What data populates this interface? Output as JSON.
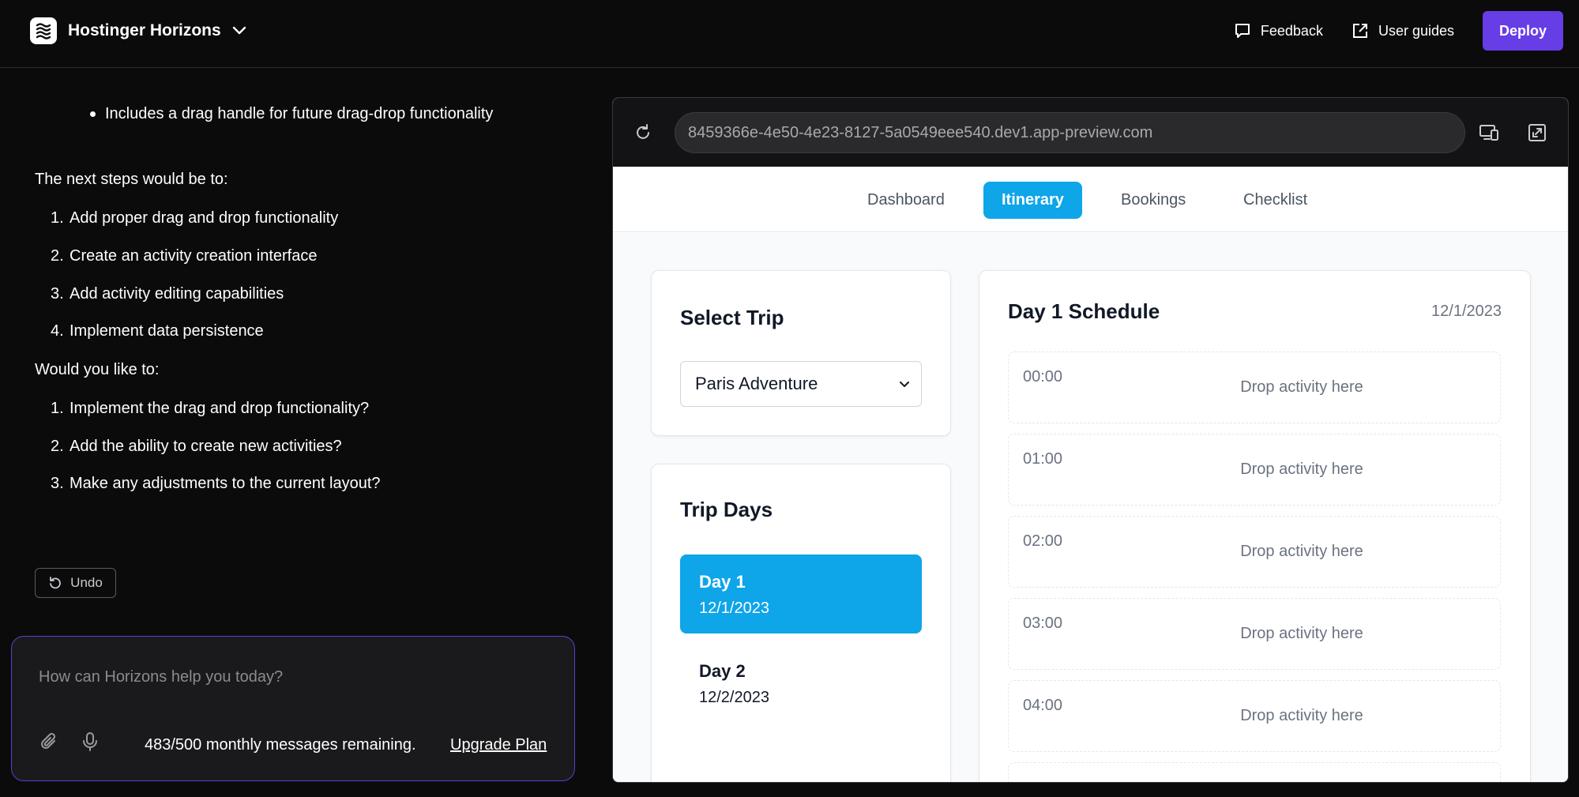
{
  "header": {
    "brand": "Hostinger Horizons",
    "feedback": "Feedback",
    "user_guides": "User guides",
    "deploy": "Deploy"
  },
  "chat": {
    "bullet": "Includes a drag handle for future drag-drop functionality",
    "next_steps_intro": "The next steps would be to:",
    "next_steps": [
      {
        "num": "1.",
        "text": "Add proper drag and drop functionality"
      },
      {
        "num": "2.",
        "text": "Create an activity creation interface"
      },
      {
        "num": "3.",
        "text": "Add activity editing capabilities"
      },
      {
        "num": "4.",
        "text": "Implement data persistence"
      }
    ],
    "would_you_intro": "Would you like to:",
    "would_you": [
      {
        "num": "1.",
        "text": "Implement the drag and drop functionality?"
      },
      {
        "num": "2.",
        "text": "Add the ability to create new activities?"
      },
      {
        "num": "3.",
        "text": "Make any adjustments to the current layout?"
      }
    ],
    "undo": "Undo",
    "composer_placeholder": "How can Horizons help you today?",
    "quota": "483/500 monthly messages remaining.",
    "upgrade": "Upgrade Plan"
  },
  "preview": {
    "url": "8459366e-4e50-4e23-8127-5a0549eee540.dev1.app-preview.com"
  },
  "app": {
    "tabs": [
      {
        "label": "Dashboard",
        "active": false
      },
      {
        "label": "Itinerary",
        "active": true
      },
      {
        "label": "Bookings",
        "active": false
      },
      {
        "label": "Checklist",
        "active": false
      }
    ],
    "select_trip": {
      "title": "Select Trip",
      "value": "Paris Adventure"
    },
    "trip_days": {
      "title": "Trip Days",
      "days": [
        {
          "title": "Day 1",
          "date": "12/1/2023",
          "active": true
        },
        {
          "title": "Day 2",
          "date": "12/2/2023",
          "active": false
        }
      ]
    },
    "schedule": {
      "title": "Day 1 Schedule",
      "date": "12/1/2023",
      "slots": [
        {
          "time": "00:00",
          "drop": "Drop activity here"
        },
        {
          "time": "01:00",
          "drop": "Drop activity here"
        },
        {
          "time": "02:00",
          "drop": "Drop activity here"
        },
        {
          "time": "03:00",
          "drop": "Drop activity here"
        },
        {
          "time": "04:00",
          "drop": "Drop activity here"
        }
      ]
    }
  },
  "colors": {
    "accent": "#0ea5e9",
    "deploy": "#673de6",
    "composer_border": "#5b3fd0"
  }
}
